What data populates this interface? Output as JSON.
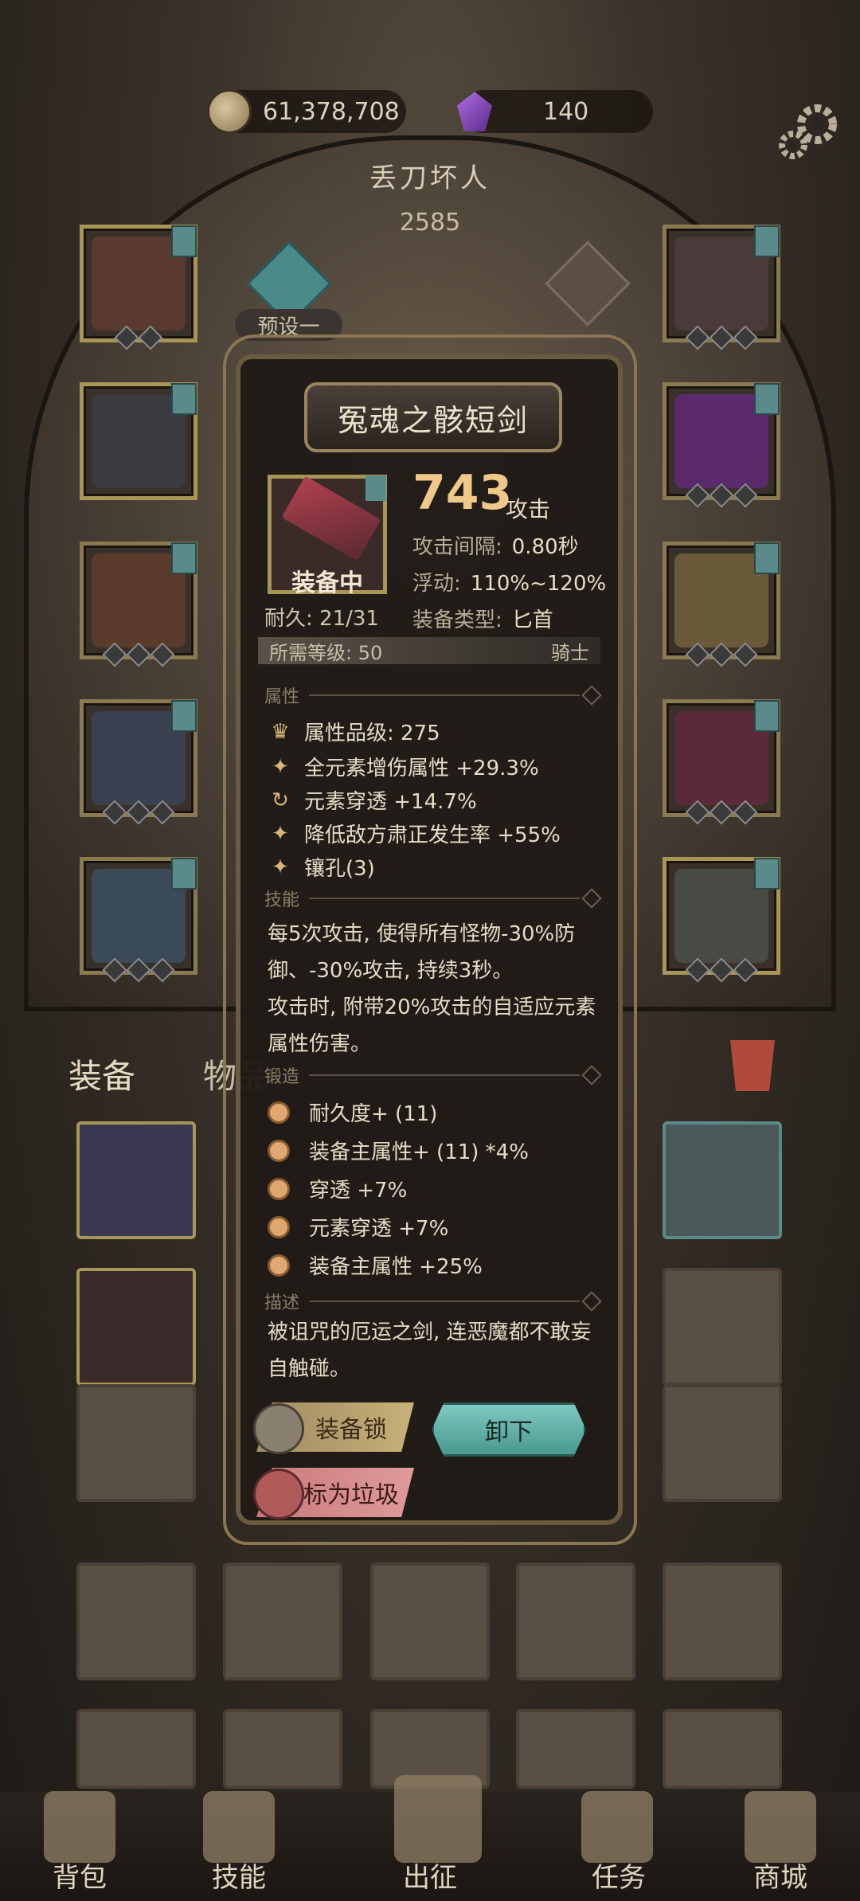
{
  "currency": {
    "gold": "61,378,708",
    "gems": "140"
  },
  "character": {
    "name": "丢刀坏人",
    "power": "2585"
  },
  "preset_label": "预设一",
  "inventory_tabs": {
    "equipment": "装备",
    "items": "物品"
  },
  "item": {
    "name": "冤魂之骸短剑",
    "status": "装备中",
    "durability_label": "耐久:",
    "durability": "21/31",
    "attack_value": "743",
    "attack_unit": "攻击",
    "attack_interval_label": "攻击间隔:",
    "attack_interval": "0.80秒",
    "float_label": "浮动:",
    "float": "110%~120%",
    "type_label": "装备类型:",
    "type": "匕首",
    "required_level_label": "所需等级:",
    "required_level": "50",
    "class": "骑士",
    "sections": {
      "attributes": "属性",
      "skills": "技能",
      "forge": "锻造",
      "description": "描述"
    },
    "attributes": [
      {
        "icon": "crown-icon",
        "text": "属性品级: 275"
      },
      {
        "icon": "sparkle-icon",
        "text": "全元素增伤属性 +29.3%"
      },
      {
        "icon": "cycle-icon",
        "text": "元素穿透 +14.7%"
      },
      {
        "icon": "sparkle-icon",
        "text": "降低敌方肃正发生率 +55%"
      },
      {
        "icon": "sparkle-icon",
        "text": "镶孔(3)"
      }
    ],
    "skills": [
      "每5次攻击, 使得所有怪物-30%防",
      "御、-30%攻击, 持续3秒。",
      "攻击时, 附带20%攻击的自适应元素",
      "属性伤害。"
    ],
    "forge": [
      "耐久度+ (11)",
      "装备主属性+ (11) *4%",
      "穿透 +7%",
      "元素穿透 +7%",
      "装备主属性 +25%"
    ],
    "description": [
      "被诅咒的厄运之剑, 连恶魔都不敢妄",
      "自触碰。"
    ]
  },
  "buttons": {
    "lock": "装备锁",
    "unequip": "卸下",
    "junk": "标为垃圾"
  },
  "nav": {
    "bag": "背包",
    "skills": "技能",
    "expedition": "出征",
    "quests": "任务",
    "shop": "商城"
  },
  "colors": {
    "accent_gold": "#f0c98a",
    "teal": "#7ec8c0",
    "junk_red": "#c87a7a"
  }
}
